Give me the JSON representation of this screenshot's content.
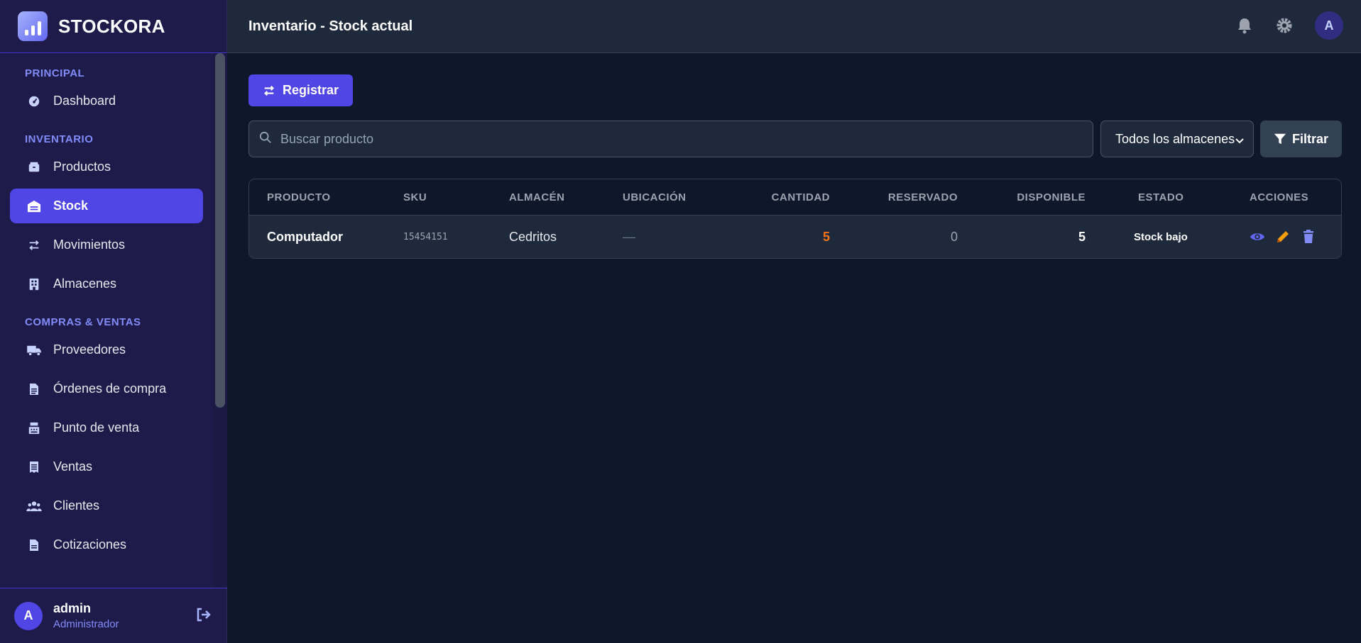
{
  "brand": {
    "name": "STOCKORA"
  },
  "header": {
    "title": "Inventario - Stock actual",
    "avatar_initial": "A"
  },
  "sidebar": {
    "sections": [
      {
        "label": "PRINCIPAL",
        "items": [
          {
            "label": "Dashboard",
            "icon": "gauge-icon"
          }
        ]
      },
      {
        "label": "INVENTARIO",
        "items": [
          {
            "label": "Productos",
            "icon": "box-icon"
          },
          {
            "label": "Stock",
            "icon": "warehouse-icon",
            "active": true
          },
          {
            "label": "Movimientos",
            "icon": "swap-icon"
          },
          {
            "label": "Almacenes",
            "icon": "building-icon"
          }
        ]
      },
      {
        "label": "COMPRAS & VENTAS",
        "items": [
          {
            "label": "Proveedores",
            "icon": "truck-icon"
          },
          {
            "label": "Órdenes de compra",
            "icon": "document-icon"
          },
          {
            "label": "Punto de venta",
            "icon": "cash-register-icon"
          },
          {
            "label": "Ventas",
            "icon": "receipt-icon"
          },
          {
            "label": "Clientes",
            "icon": "users-icon"
          },
          {
            "label": "Cotizaciones",
            "icon": "file-icon"
          }
        ]
      }
    ],
    "user": {
      "initial": "A",
      "name": "admin",
      "role": "Administrador"
    }
  },
  "main": {
    "register_label": "Registrar",
    "search_placeholder": "Buscar producto",
    "warehouse_select": "Todos los almacenes",
    "filter_label": "Filtrar",
    "table": {
      "columns": [
        "PRODUCTO",
        "SKU",
        "ALMACÉN",
        "UBICACIÓN",
        "CANTIDAD",
        "RESERVADO",
        "DISPONIBLE",
        "ESTADO",
        "ACCIONES"
      ],
      "rows": [
        {
          "producto": "Computador",
          "sku": "15454151",
          "almacen": "Cedritos",
          "ubicacion": "—",
          "cantidad": "5",
          "reservado": "0",
          "disponible": "5",
          "estado": "Stock bajo"
        }
      ]
    }
  },
  "colors": {
    "accent": "#4f46e5",
    "warning": "#f97316",
    "edit": "#f59e0b",
    "view": "#6366f1",
    "delete": "#818cf8"
  }
}
